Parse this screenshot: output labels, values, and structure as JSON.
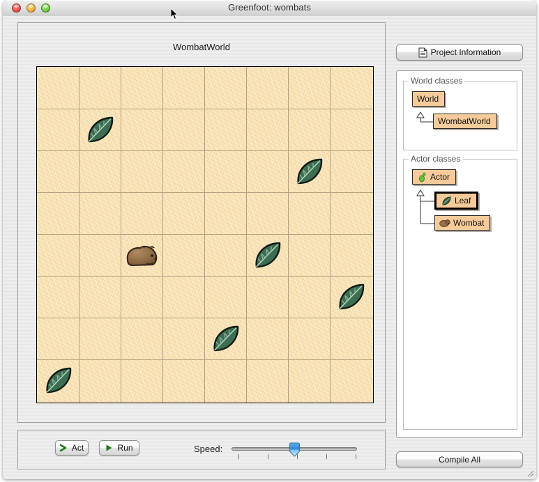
{
  "window": {
    "title": "Greenfoot: wombats",
    "traffic_lights": [
      "close",
      "minimize",
      "maximize"
    ]
  },
  "world": {
    "title": "WombatWorld",
    "grid": {
      "columns": 8,
      "rows": 8,
      "cell_size": 60
    },
    "background_color": "#f8e0b0",
    "gridline_color": "#b3a07f",
    "actors": [
      {
        "type": "Leaf",
        "col": 1,
        "row": 1
      },
      {
        "type": "Leaf",
        "col": 6,
        "row": 2
      },
      {
        "type": "Wombat",
        "col": 2,
        "row": 4
      },
      {
        "type": "Leaf",
        "col": 5,
        "row": 4
      },
      {
        "type": "Leaf",
        "col": 7,
        "row": 5
      },
      {
        "type": "Leaf",
        "col": 4,
        "row": 6
      },
      {
        "type": "Leaf",
        "col": 0,
        "row": 7
      }
    ]
  },
  "controls": {
    "act_label": "Act",
    "run_label": "Run",
    "act_icon": "chevron-right-icon",
    "run_icon": "play-triangle-icon",
    "speed_label": "Speed:",
    "speed_value": 50,
    "speed_ticks": 5
  },
  "sidebar": {
    "project_info_label": "Project Information",
    "project_info_icon": "document-icon",
    "compile_label": "Compile All",
    "world_group_label": "World classes",
    "actor_group_label": "Actor classes",
    "world_classes": [
      {
        "name": "World",
        "icon": null,
        "selected": false
      },
      {
        "name": "WombatWorld",
        "icon": null,
        "selected": false
      }
    ],
    "actor_classes": [
      {
        "name": "Actor",
        "icon": "actor-footprint-icon",
        "selected": false
      },
      {
        "name": "Leaf",
        "icon": "leaf-icon",
        "selected": true
      },
      {
        "name": "Wombat",
        "icon": "wombat-icon",
        "selected": false
      }
    ]
  },
  "colors": {
    "class_box": "#f6cb99",
    "world_sand": "#f8e0b0",
    "leaf_green": "#3c6b4e",
    "wombat_brown": "#8a6645",
    "slider_thumb": "#4da3e8"
  }
}
